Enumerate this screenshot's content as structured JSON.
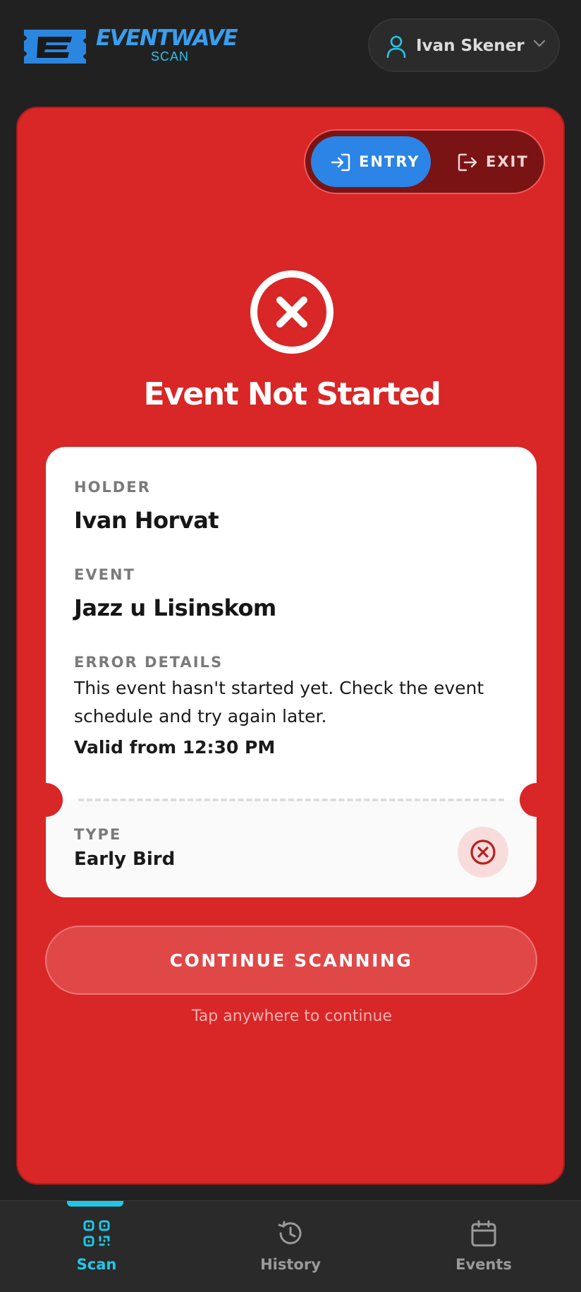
{
  "header": {
    "logo_text": "EVENTWAVE",
    "logo_sub": "SCAN",
    "user_name": "Ivan Skener"
  },
  "mode_toggle": {
    "entry_label": "ENTRY",
    "exit_label": "EXIT",
    "selected": "ENTRY"
  },
  "result": {
    "title": "Event Not Started",
    "holder_label": "HOLDER",
    "holder_value": "Ivan Horvat",
    "event_label": "EVENT",
    "event_value": "Jazz u Lisinskom",
    "error_label": "ERROR DETAILS",
    "error_text": "This event hasn't started yet. Check the event schedule and try again later.",
    "valid_text": "Valid from 12:30 PM",
    "type_label": "TYPE",
    "type_value": "Early Bird"
  },
  "actions": {
    "continue_label": "CONTINUE SCANNING",
    "tap_hint": "Tap anywhere to continue"
  },
  "bottom_nav": {
    "items": [
      {
        "label": "Scan",
        "icon": "qr-scan-icon",
        "active": true
      },
      {
        "label": "History",
        "icon": "history-icon",
        "active": false
      },
      {
        "label": "Events",
        "icon": "calendar-icon",
        "active": false
      }
    ]
  },
  "colors": {
    "error_red": "#d92626",
    "accent_cyan": "#22c7e6",
    "entry_blue": "#2b84e6",
    "background": "#212121"
  }
}
